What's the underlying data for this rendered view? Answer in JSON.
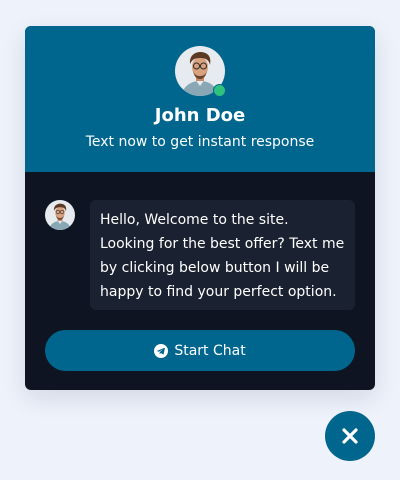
{
  "header": {
    "name": "John Doe",
    "subtitle": "Text now to get instant response",
    "online": true
  },
  "message": {
    "text": "Hello, Welcome to the site. Looking for the best offer? Text me by clicking below button I will be happy to find your perfect option."
  },
  "cta": {
    "label": "Start Chat",
    "icon": "telegram-icon"
  },
  "toggle": {
    "icon": "close-icon"
  },
  "colors": {
    "accent": "#00668d",
    "panel": "#0e1422",
    "bubble": "#1a2130",
    "online": "#2ec27e",
    "page": "#eef2fb"
  }
}
